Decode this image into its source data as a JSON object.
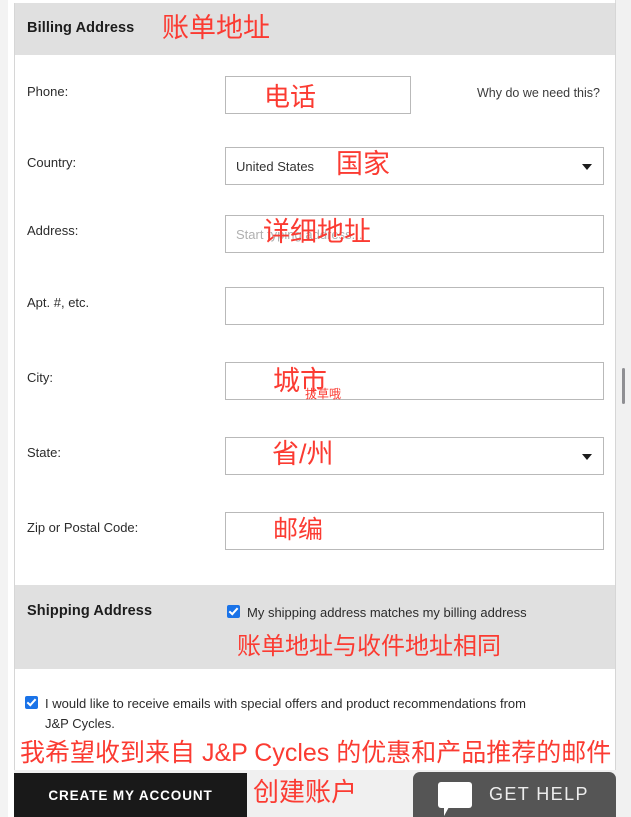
{
  "billing": {
    "section_title": "Billing Address",
    "annotation": "账单地址",
    "fields": {
      "phone": {
        "label": "Phone:",
        "value": "",
        "annotation": "电话",
        "hint_link": "Why do we need this?"
      },
      "country": {
        "label": "Country:",
        "value": "United States",
        "annotation": "国家",
        "caret_icon": "chevron-down-icon"
      },
      "address": {
        "label": "Address:",
        "value": "",
        "placeholder": "Start typing address...",
        "annotation": "详细地址"
      },
      "apt": {
        "label": "Apt. #, etc.",
        "value": "",
        "placeholder": ""
      },
      "city": {
        "label": "City:",
        "value": "",
        "annotation": "城市",
        "watermark": "拔草哦"
      },
      "state": {
        "label": "State:",
        "value": "",
        "annotation": "省/州",
        "caret_icon": "chevron-down-icon"
      },
      "zip": {
        "label": "Zip or Postal Code:",
        "value": "",
        "annotation": "邮编"
      }
    }
  },
  "shipping": {
    "section_title": "Shipping Address",
    "match_checkbox": {
      "label": "My shipping address matches my billing address",
      "checked": true,
      "annotation": "账单地址与收件地址相同"
    }
  },
  "optin": {
    "label_line1": "I would like to receive emails with special offers and product recommendations from",
    "label_line2": "J&P Cycles.",
    "checked": true,
    "annotation": "我希望收到来自 J&P Cycles 的优惠和产品推荐的邮件"
  },
  "footer": {
    "create_account_label": "CREATE MY ACCOUNT",
    "create_account_annotation": "创建账户",
    "get_help_label": "GET HELP",
    "get_help_icon": "chat-bubble-icon"
  },
  "colors": {
    "annotation_red": "#fb3b32",
    "section_band": "#e0e0e0",
    "checkbox_blue": "#1a73e8",
    "primary_button": "#191919",
    "help_button": "#555555"
  }
}
